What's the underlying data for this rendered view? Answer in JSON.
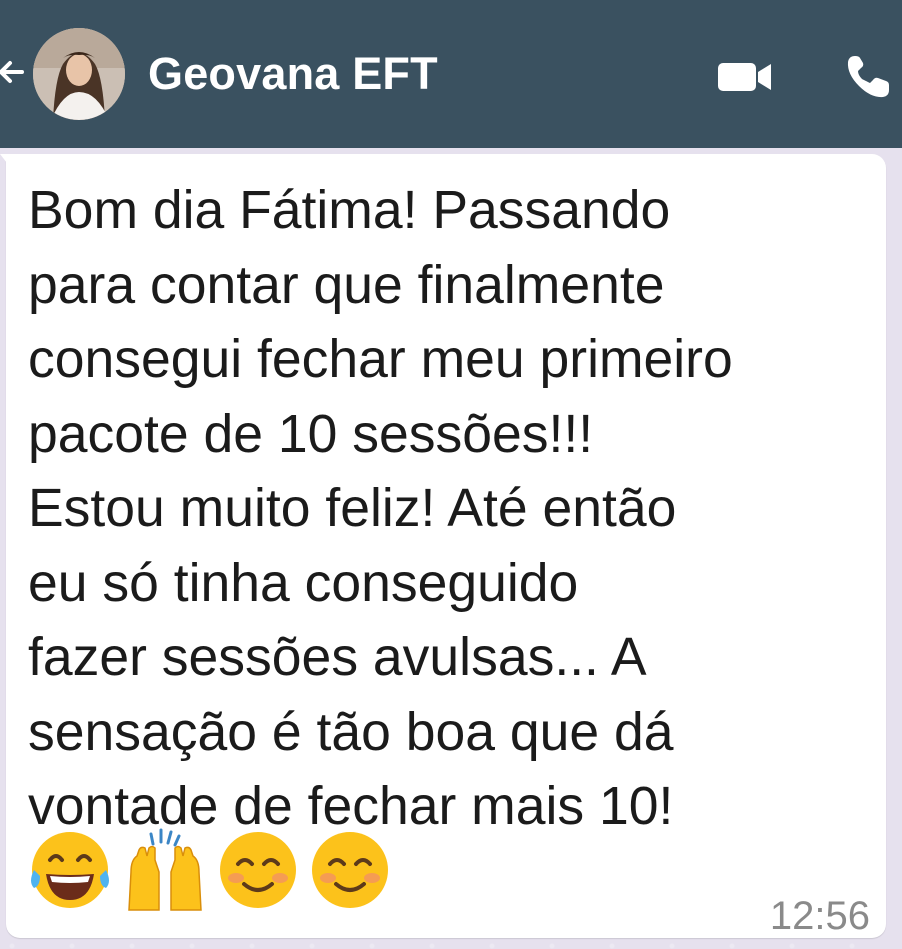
{
  "header": {
    "contact_name": "Geovana EFT",
    "background_color": "#3a5160",
    "icons": [
      "back-arrow-icon",
      "avatar",
      "video-call-icon",
      "phone-call-icon"
    ]
  },
  "message": {
    "lines": [
      "Bom dia Fátima! Passando",
      "para contar que finalmente",
      "consegui fechar meu primeiro",
      "pacote de 10 sessões!!!",
      "Estou muito feliz! Até então",
      "eu só tinha conseguido",
      "fazer sessões avulsas... A",
      "sensação é tão boa que dá",
      "vontade de fechar mais 10!"
    ],
    "emojis": [
      "tears-of-joy-emoji",
      "raising-hands-emoji",
      "smiling-face-emoji",
      "smiling-face-emoji"
    ],
    "time": "12:56"
  }
}
